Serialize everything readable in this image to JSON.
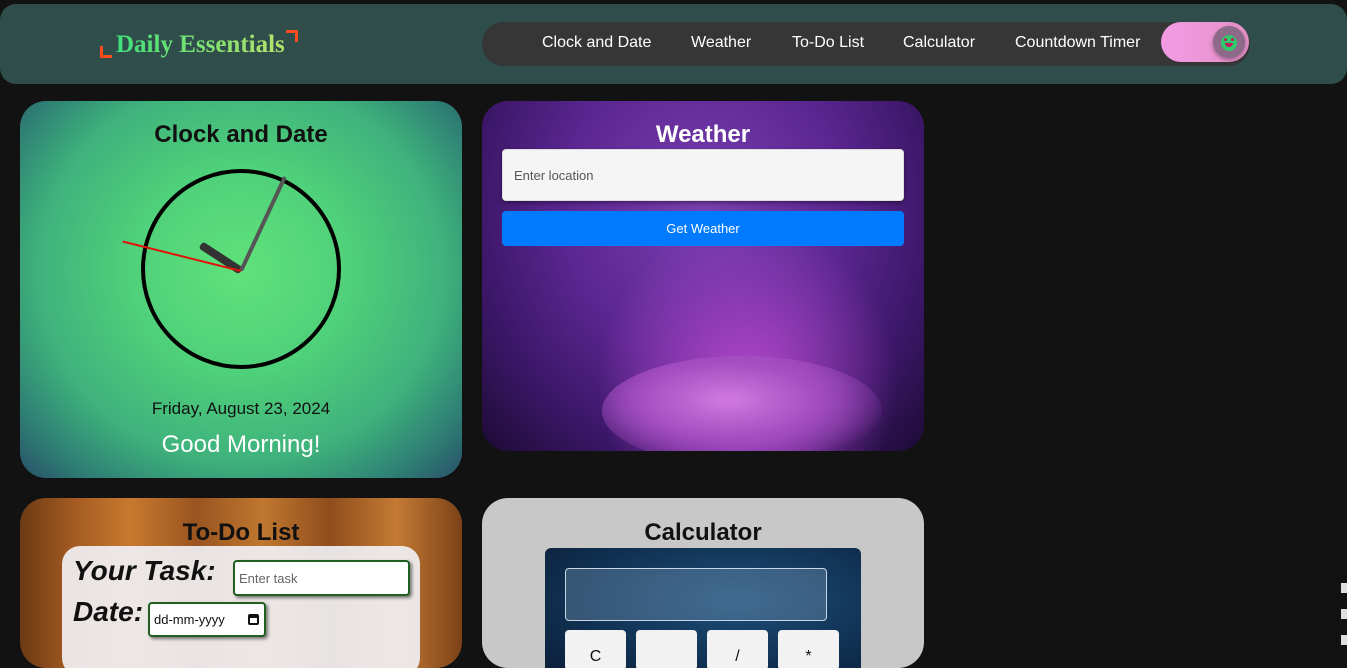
{
  "header": {
    "logo_text": "Daily Essentials",
    "nav": [
      {
        "label": "Clock and Date"
      },
      {
        "label": "Weather"
      },
      {
        "label": "To-Do List"
      },
      {
        "label": "Calculator"
      },
      {
        "label": "Countdown Timer"
      }
    ],
    "theme_toggle_icon": "smiley-face-icon"
  },
  "clock": {
    "title": "Clock and Date",
    "date": "Friday, August 23, 2024",
    "greeting": "Good Morning!"
  },
  "weather": {
    "title": "Weather",
    "location_placeholder": "Enter location",
    "button_label": "Get Weather"
  },
  "todo": {
    "title": "To-Do List",
    "task_label": "Your Task:",
    "task_placeholder": "Enter task",
    "date_label": "Date:",
    "date_placeholder": "dd-mm-yyyy"
  },
  "calculator": {
    "title": "Calculator",
    "keys": [
      "C",
      "",
      "/",
      "*"
    ]
  },
  "colors": {
    "accent_orange": "#ff4a1c",
    "button_blue": "#007bff",
    "header_bg": "#2e4d4b"
  }
}
